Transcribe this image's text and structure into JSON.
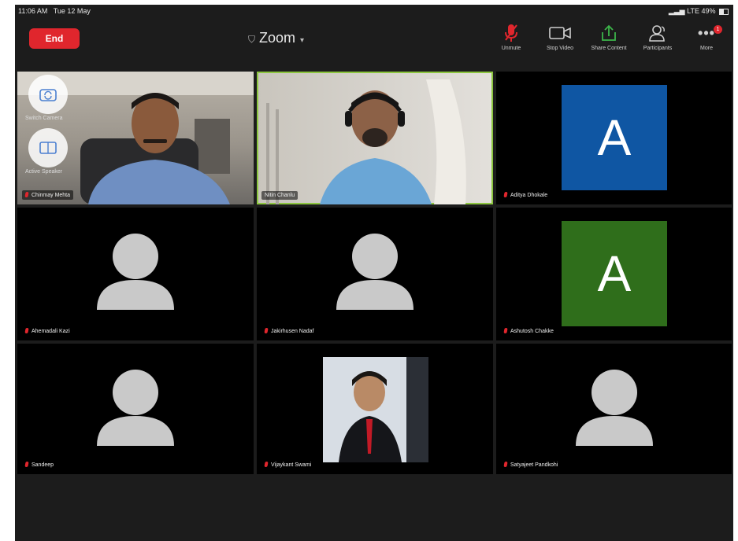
{
  "status_bar": {
    "time": "11:06 AM",
    "date": "Tue 12 May",
    "network": "LTE",
    "battery": "49%"
  },
  "toolbar": {
    "end_label": "End",
    "title": "Zoom",
    "items": [
      {
        "label": "Unmute",
        "icon": "mic-muted-icon"
      },
      {
        "label": "Stop Video",
        "icon": "video-camera-icon"
      },
      {
        "label": "Share Content",
        "icon": "share-up-arrow-icon"
      },
      {
        "label": "Participants",
        "icon": "participants-icon"
      },
      {
        "label": "More",
        "icon": "more-dots-icon",
        "badge": "1"
      }
    ]
  },
  "floating": {
    "switch_camera_label": "Switch Camera",
    "gallery_view_label": "Active Speaker"
  },
  "participants": [
    {
      "name": "Chinmay Mehta",
      "type": "video"
    },
    {
      "name": "Nitin Chanlu",
      "type": "video",
      "active": true
    },
    {
      "name": "Aditya Dhokale",
      "type": "letter",
      "letter": "A",
      "color": "#0f56a3"
    },
    {
      "name": "Ahemadali Kazi",
      "type": "silhouette"
    },
    {
      "name": "Jakirhusen Nadaf",
      "type": "silhouette"
    },
    {
      "name": "Ashutosh Chakke",
      "type": "letter",
      "letter": "A",
      "color": "#2f6e1b"
    },
    {
      "name": "Sandeep",
      "type": "silhouette"
    },
    {
      "name": "Vijaykant Swami",
      "type": "photo"
    },
    {
      "name": "Satyajeet Pandkohi",
      "type": "silhouette"
    }
  ],
  "colors": {
    "accent_red": "#e0262d",
    "active_border": "#8cc63f",
    "background": "#1c1c1c"
  }
}
